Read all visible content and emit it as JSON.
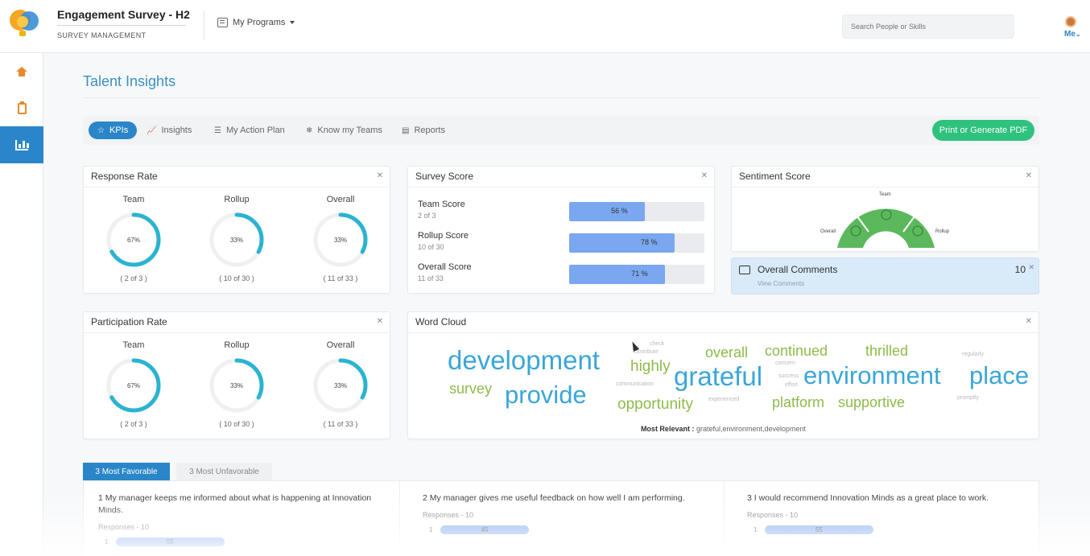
{
  "header": {
    "app_title": "Engagement Survey - H2",
    "app_subtitle": "SURVEY MANAGEMENT",
    "programs_label": "My Programs",
    "search_placeholder": "Search People or Skills",
    "me_label": "Me"
  },
  "page_title": "Talent Insights",
  "tabs": [
    {
      "label": "KPIs",
      "icon": "star-icon",
      "active": true
    },
    {
      "label": "Insights",
      "icon": "line-chart-icon"
    },
    {
      "label": "My Action Plan",
      "icon": "list-icon"
    },
    {
      "label": "Know my Teams",
      "icon": "snowflake-icon"
    },
    {
      "label": "Reports",
      "icon": "document-icon"
    }
  ],
  "pdf_button": "Print or Generate PDF",
  "response_rate": {
    "title": "Response Rate",
    "items": [
      {
        "label": "Team",
        "pct_label": "67%",
        "pct": 67,
        "count": "( 2 of 3 )"
      },
      {
        "label": "Rollup",
        "pct_label": "33%",
        "pct": 33,
        "count": "( 10 of 30 )"
      },
      {
        "label": "Overall",
        "pct_label": "33%",
        "pct": 33,
        "count": "( 11 of 33 )"
      }
    ]
  },
  "participation_rate": {
    "title": "Participation Rate",
    "items": [
      {
        "label": "Team",
        "pct_label": "67%",
        "pct": 67,
        "count": "( 2 of 3 )"
      },
      {
        "label": "Rollup",
        "pct_label": "33%",
        "pct": 33,
        "count": "( 10 of 30 )"
      },
      {
        "label": "Overall",
        "pct_label": "33%",
        "pct": 33,
        "count": "( 11 of 33 )"
      }
    ]
  },
  "survey_score": {
    "title": "Survey Score",
    "rows": [
      {
        "name": "Team Score",
        "sub": "2 of 3",
        "pct_label": "56 %",
        "pct": 56
      },
      {
        "name": "Rollup Score",
        "sub": "10 of 30",
        "pct_label": "78 %",
        "pct": 78
      },
      {
        "name": "Overall Score",
        "sub": "11 of 33",
        "pct_label": "71 %",
        "pct": 71
      }
    ]
  },
  "sentiment": {
    "title": "Sentiment Score",
    "labels": [
      "Overall",
      "Team",
      "Rollup"
    ]
  },
  "comments": {
    "title": "Overall Comments",
    "link": "View Comments",
    "count": "10"
  },
  "word_cloud": {
    "title": "Word Cloud",
    "words": [
      {
        "text": "development",
        "size": "lg",
        "color": "#3aa6d8"
      },
      {
        "text": "provide",
        "size": "lg",
        "color": "#3aa6d8"
      },
      {
        "text": "grateful",
        "size": "lg",
        "color": "#3aa6d8"
      },
      {
        "text": "environment",
        "size": "lg",
        "color": "#3aa6d8"
      },
      {
        "text": "place",
        "size": "lg",
        "color": "#3aa6d8"
      },
      {
        "text": "survey",
        "size": "md",
        "color": "#8dbb4a"
      },
      {
        "text": "highly",
        "size": "md",
        "color": "#8dbb4a"
      },
      {
        "text": "overall",
        "size": "md",
        "color": "#8dbb4a"
      },
      {
        "text": "continued",
        "size": "md",
        "color": "#8dbb4a"
      },
      {
        "text": "thrilled",
        "size": "md",
        "color": "#8dbb4a"
      },
      {
        "text": "opportunity",
        "size": "md",
        "color": "#8dbb4a"
      },
      {
        "text": "platform",
        "size": "md",
        "color": "#8dbb4a"
      },
      {
        "text": "supportive",
        "size": "md",
        "color": "#8dbb4a"
      },
      {
        "text": "check",
        "size": "sm",
        "color": "#b5b9bf"
      },
      {
        "text": "contribute",
        "size": "sm",
        "color": "#b5b9bf"
      },
      {
        "text": "concern",
        "size": "sm",
        "color": "#b5b9bf"
      },
      {
        "text": "regularly",
        "size": "sm",
        "color": "#b5b9bf"
      },
      {
        "text": "communication",
        "size": "sm",
        "color": "#b5b9bf"
      },
      {
        "text": "success",
        "size": "sm",
        "color": "#b5b9bf"
      },
      {
        "text": "effort",
        "size": "sm",
        "color": "#b5b9bf"
      },
      {
        "text": "experienced",
        "size": "sm",
        "color": "#b5b9bf"
      },
      {
        "text": "promptly",
        "size": "sm",
        "color": "#b5b9bf"
      }
    ],
    "most_relevant_label": "Most Relevant :",
    "most_relevant_value": "grateful,environment,development"
  },
  "favorable": {
    "tab_active": "3 Most Favorable",
    "tab_inactive": "3 Most Unfavorable",
    "items": [
      {
        "question": "1  My manager keeps me informed about what is happening at Innovation Minds.",
        "responses": "Responses - 10",
        "bar_label": "55",
        "bar_row": "1",
        "pct": 55
      },
      {
        "question": "2  My manager gives me useful feedback on how well I am performing.",
        "responses": "Responses - 10",
        "bar_label": "45",
        "bar_row": "1",
        "pct": 45
      },
      {
        "question": "3  I would recommend Innovation Minds as a great place to work.",
        "responses": "Responses - 10",
        "bar_label": "55",
        "bar_row": "1",
        "pct": 55
      }
    ]
  },
  "colors": {
    "accent": "#2a86c9",
    "ring": "#2bb3d1",
    "score_bar": "#7aa7ef",
    "sentiment": "#5cb85c",
    "pdf_button": "#2ec27e"
  }
}
